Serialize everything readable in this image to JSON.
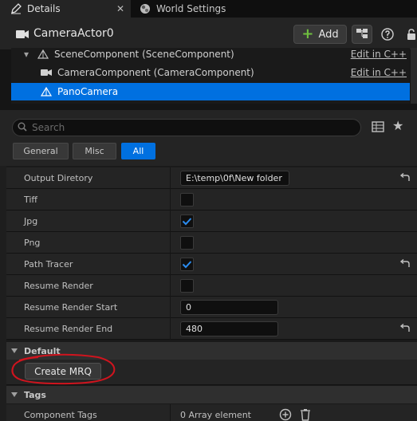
{
  "tabs": {
    "details_label": "Details",
    "world_settings_label": "World Settings",
    "close_glyph": "✕"
  },
  "actor": {
    "name": "CameraActor0",
    "add_label": "Add"
  },
  "components": [
    {
      "label": "SceneComponent (SceneComponent)",
      "edit": "Edit in C++"
    },
    {
      "label": "CameraComponent (CameraComponent)",
      "edit": "Edit in C++"
    },
    {
      "label": "PanoCamera",
      "edit": ""
    }
  ],
  "search": {
    "placeholder": "Search"
  },
  "filters": {
    "general": "General",
    "misc": "Misc",
    "all": "All",
    "active": "All"
  },
  "properties": {
    "output_directory": {
      "label": "Output Diretory",
      "value": "E:\\temp\\0f\\New folder"
    },
    "tiff": {
      "label": "Tiff",
      "checked": false
    },
    "jpg": {
      "label": "Jpg",
      "checked": true
    },
    "png": {
      "label": "Png",
      "checked": false
    },
    "path_tracer": {
      "label": "Path Tracer",
      "checked": true
    },
    "resume_render": {
      "label": "Resume Render",
      "checked": false
    },
    "resume_render_start": {
      "label": "Resume Render Start",
      "value": "0"
    },
    "resume_render_end": {
      "label": "Resume Render End",
      "value": "480"
    }
  },
  "categories": {
    "default": "Default",
    "tags": "Tags"
  },
  "default_section": {
    "create_mrq_label": "Create MRQ"
  },
  "tags_section": {
    "component_tags_label": "Component Tags",
    "component_tags_value": "0 Array element"
  },
  "colors": {
    "accent": "#0070e0",
    "annotation": "#d0141e",
    "add_plus": "#6fbf3f"
  }
}
